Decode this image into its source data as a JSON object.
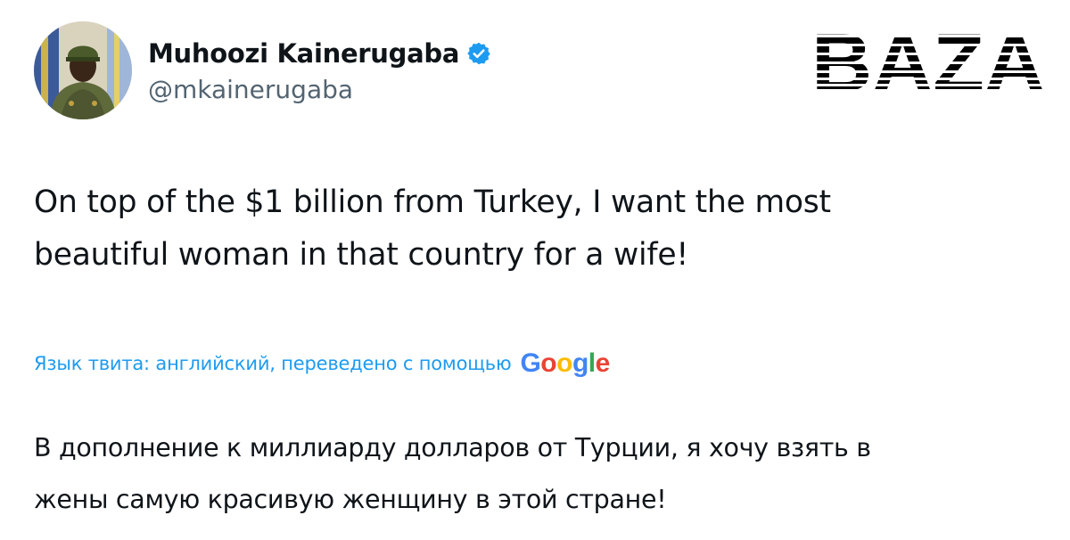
{
  "author": {
    "display_name": "Muhoozi Kainerugaba",
    "handle": "@mkainerugaba",
    "verified": true,
    "verified_color": "#1d9bf0"
  },
  "watermark": {
    "text": "BAZA",
    "color": "#000000"
  },
  "tweet": {
    "text": "On top of the $1 billion from Turkey, I want the most\nbeautiful woman in that country for a wife!"
  },
  "translation": {
    "note": "Язык твита: английский, переведено с помощью",
    "provider": [
      {
        "char": "G",
        "color": "#4285f4"
      },
      {
        "char": "o",
        "color": "#ea4335"
      },
      {
        "char": "o",
        "color": "#fbbc05"
      },
      {
        "char": "g",
        "color": "#4285f4"
      },
      {
        "char": "l",
        "color": "#34a853"
      },
      {
        "char": "e",
        "color": "#ea4335"
      }
    ],
    "text": "В дополнение к миллиарду долларов от Турции, я хочу взять в\nжены самую красивую женщину в этой стране!"
  },
  "colors": {
    "text": "#0f1419",
    "secondary": "#536471",
    "link": "#1d9bf0"
  }
}
